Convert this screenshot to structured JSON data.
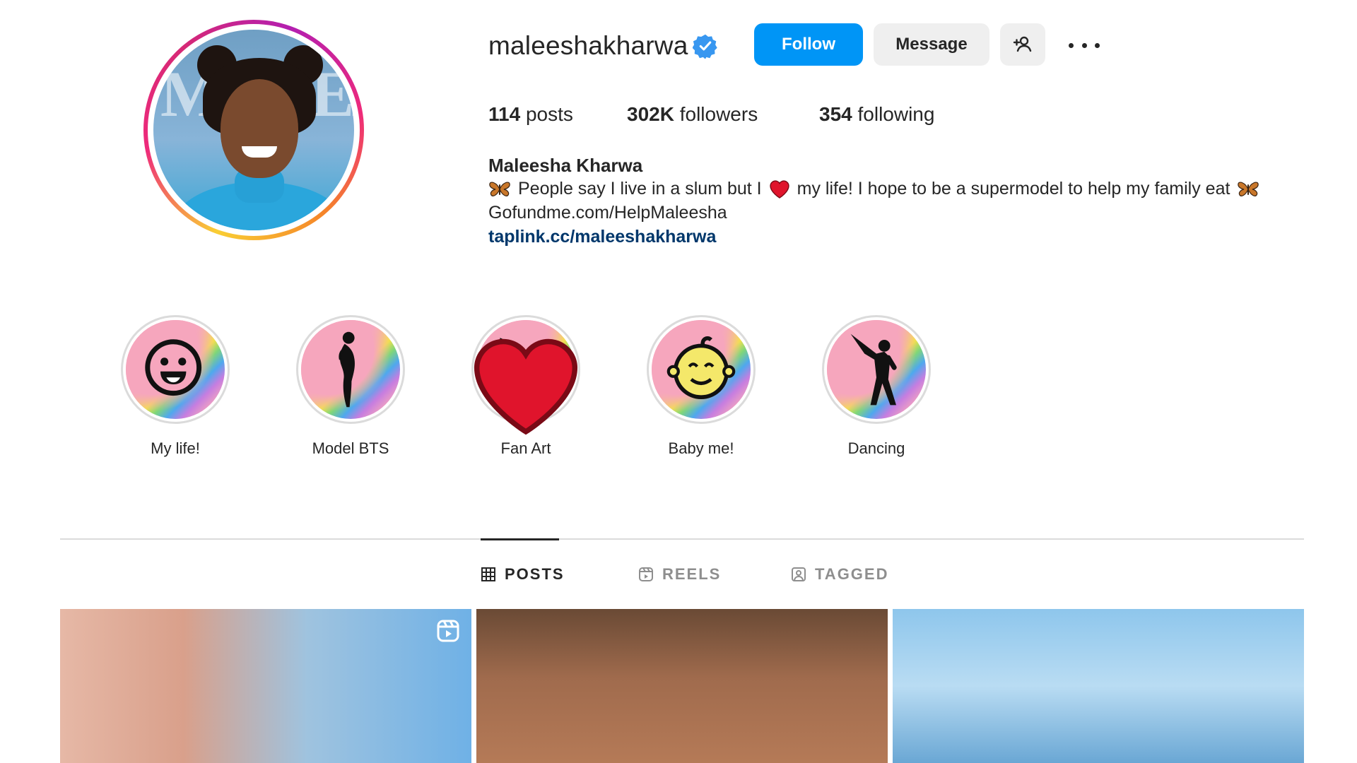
{
  "profile": {
    "username": "maleeshakharwa",
    "verified": true,
    "actions": {
      "follow_label": "Follow",
      "message_label": "Message",
      "add_user_icon": "person-add-icon",
      "more_icon": "more-options-icon"
    },
    "stats": {
      "posts_count": "114",
      "posts_label": " posts",
      "followers_count": "302K",
      "followers_label": " followers",
      "following_count": "354",
      "following_label": " following"
    },
    "full_name": "Maleesha Kharwa",
    "bio_text_1": "People say I live in a slum but I",
    "bio_text_2": "my life! I hope to be a supermodel to help my family eat",
    "bio_line2": "Gofundme.com/HelpMaleesha",
    "link": "taplink.cc/maleeshakharwa"
  },
  "highlights": [
    {
      "label": "My life!",
      "icon": "smiley-face-icon"
    },
    {
      "label": "Model BTS",
      "icon": "model-silhouette-icon"
    },
    {
      "label": "Fan Art",
      "icon": "paintbrush-icon",
      "heart": true
    },
    {
      "label": "Baby me!",
      "icon": "baby-face-icon"
    },
    {
      "label": "Dancing",
      "icon": "dancer-icon"
    }
  ],
  "tabs": [
    {
      "label": "POSTS",
      "icon": "grid-icon",
      "active": true
    },
    {
      "label": "REELS",
      "icon": "reels-icon",
      "active": false
    },
    {
      "label": "TAGGED",
      "icon": "tagged-icon",
      "active": false
    }
  ],
  "colors": {
    "follow_button": "#0095f6",
    "secondary_button": "#efefef",
    "link": "#00376b",
    "verified": "#3897f0",
    "highlight_bg": "#f6a6bd"
  }
}
